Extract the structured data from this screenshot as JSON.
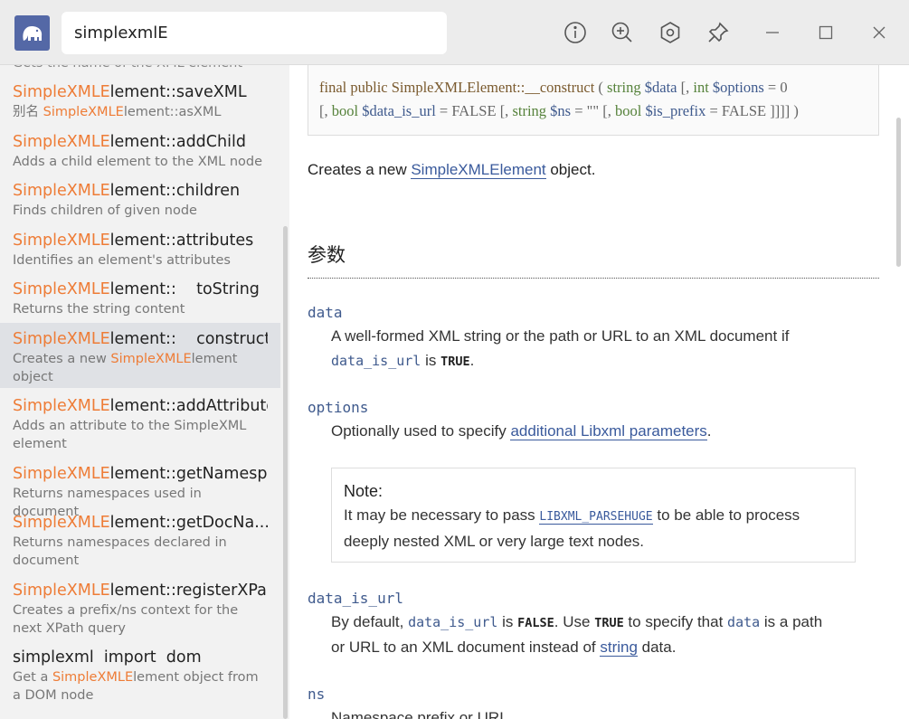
{
  "search": {
    "value": "simplexmlE"
  },
  "sidebar": {
    "partial_text": "Gets the name of the XML element",
    "items": [
      {
        "prefix": "SimpleXMLE",
        "rest": "lement::saveXML",
        "desc_pre": "别名 ",
        "desc_hl": "SimpleXMLE",
        "desc_post": "lement::asXML"
      },
      {
        "prefix": "SimpleXMLE",
        "rest": "lement::addChild",
        "desc_pre": "Adds a child element to the XML node",
        "desc_hl": "",
        "desc_post": ""
      },
      {
        "prefix": "SimpleXMLE",
        "rest": "lement::children",
        "desc_pre": "Finds children of given node",
        "desc_hl": "",
        "desc_post": ""
      },
      {
        "prefix": "SimpleXMLE",
        "rest": "lement::attributes",
        "desc_pre": "Identifies an element's attributes",
        "desc_hl": "",
        "desc_post": ""
      },
      {
        "prefix": "SimpleXMLE",
        "rest": "lement::    toString",
        "desc_pre": "Returns the string content",
        "desc_hl": "",
        "desc_post": ""
      },
      {
        "prefix": "SimpleXMLE",
        "rest": "lement::    construct",
        "desc_pre": "Creates a new ",
        "desc_hl": "SimpleXMLE",
        "desc_post": "lement object"
      },
      {
        "prefix": "SimpleXMLE",
        "rest": "lement::addAttribute",
        "desc_pre": "Adds an attribute to the SimpleXML element",
        "desc_hl": "",
        "desc_post": ""
      },
      {
        "prefix": "SimpleXMLE",
        "rest": "lement::getNamesp...",
        "desc_pre": "Returns namespaces used in document",
        "desc_hl": "",
        "desc_post": ""
      },
      {
        "prefix": "SimpleXMLE",
        "rest": "lement::getDocNa...",
        "desc_pre": "Returns namespaces declared in document",
        "desc_hl": "",
        "desc_post": ""
      },
      {
        "prefix": "SimpleXMLE",
        "rest": "lement::registerXPa...",
        "desc_pre": "Creates a prefix/ns context for the next XPath query",
        "desc_hl": "",
        "desc_post": ""
      },
      {
        "prefix": "",
        "rest": "simplexml  import  dom",
        "desc_pre": "Get a ",
        "desc_hl": "SimpleXMLE",
        "desc_post": "lement object from a DOM node"
      }
    ]
  },
  "main": {
    "synopsis": {
      "final": "final",
      "public": "public",
      "method": "SimpleXMLElement::__construct",
      "open": "(",
      "t_string": "string",
      "v_data": "$data",
      "br1": "[,",
      "t_int": "int",
      "v_options": "$options",
      "eq0": "= 0",
      "br2": "[,",
      "t_bool1": "bool",
      "v_data_is_url": "$data_is_url",
      "eq_false1": "= FALSE",
      "br3": "[,",
      "t_string2": "string",
      "v_ns": "$ns",
      "eq_empty": "= \"\"",
      "br4": "[,",
      "t_bool2": "bool",
      "v_is_prefix": "$is_prefix",
      "eq_false2": "= FALSE",
      "close": "]]]] )"
    },
    "intro_pre": "Creates a new ",
    "intro_link": "SimpleXMLElement",
    "intro_post": " object.",
    "section_title": "参数",
    "params": {
      "data": {
        "name": "data",
        "desc_pre": "A well-formed XML string or the path or URL to an XML document if",
        "code": "data_is_url",
        "mid": " is ",
        "const": "TRUE",
        "end": "."
      },
      "options": {
        "name": "options",
        "desc_pre": "Optionally used to specify ",
        "link": "additional Libxml parameters",
        "end": "."
      },
      "note": {
        "title": "Note:",
        "pre": "It may be necessary to pass ",
        "const_link": "LIBXML_PARSEHUGE",
        "post": " to be able to process",
        "line2": "deeply nested XML or very large text nodes."
      },
      "data_is_url": {
        "name": "data_is_url",
        "pre": "By default, ",
        "code": "data_is_url",
        "is": " is ",
        "false": "FALSE",
        "use": ". Use ",
        "true": "TRUE",
        "to": " to specify that ",
        "code2": "data",
        "is_path": " is a path",
        "line2_pre": "or URL to an XML document instead of ",
        "line2_link": "string",
        "line2_post": " data."
      },
      "ns": {
        "name": "ns",
        "desc": "Namespace prefix or URI."
      }
    }
  },
  "colors": {
    "highlight": "#ee7c36",
    "link": "#3a5a9c",
    "accent": "#5468a6"
  }
}
